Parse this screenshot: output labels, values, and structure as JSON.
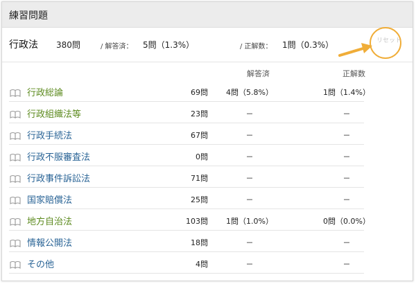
{
  "header": {
    "title": "練習問題"
  },
  "summary": {
    "subject": "行政法",
    "total": "380問",
    "answered_label": "/ 解答済：",
    "answered_value": "5問（1.3%）",
    "correct_label": "/ 正解数：",
    "correct_value": "1問（0.3%）",
    "reset_label": "リセット"
  },
  "columns": {
    "answered": "解答済",
    "correct": "正解数"
  },
  "colors": {
    "link": "#2a6496",
    "answered_link": "#5c8a1e",
    "highlight": "#f0ad38"
  },
  "rows": [
    {
      "name": "行政総論",
      "count": "69問",
      "answered": "4問（5.8%）",
      "correct": "1問（1.4%）",
      "done": true
    },
    {
      "name": "行政組織法等",
      "count": "23問",
      "answered": "－",
      "correct": "－",
      "done": true
    },
    {
      "name": "行政手続法",
      "count": "67問",
      "answered": "－",
      "correct": "－",
      "done": false
    },
    {
      "name": "行政不服審査法",
      "count": "0問",
      "answered": "－",
      "correct": "－",
      "done": false
    },
    {
      "name": "行政事件訴訟法",
      "count": "71問",
      "answered": "－",
      "correct": "－",
      "done": false
    },
    {
      "name": "国家賠償法",
      "count": "25問",
      "answered": "－",
      "correct": "－",
      "done": false
    },
    {
      "name": "地方自治法",
      "count": "103問",
      "answered": "1問（1.0%）",
      "correct": "0問（0.0%）",
      "done": true
    },
    {
      "name": "情報公開法",
      "count": "18問",
      "answered": "－",
      "correct": "－",
      "done": false
    },
    {
      "name": "その他",
      "count": "4問",
      "answered": "－",
      "correct": "－",
      "done": false
    }
  ]
}
